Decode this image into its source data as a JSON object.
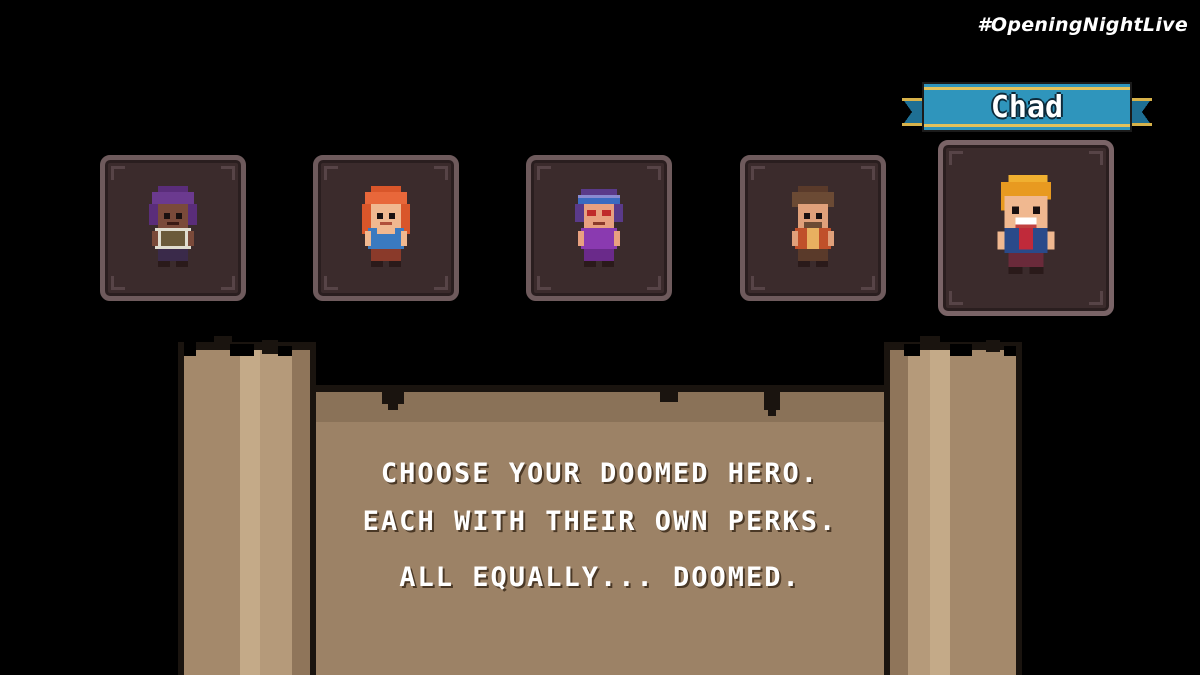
{
  "overlay": {
    "hashtag": "#OpeningNightLive"
  },
  "selection": {
    "selected_name": "Chad",
    "banner_color": "#2f95bc",
    "slots": [
      {
        "hero": "purple-hair-hero",
        "selected": false
      },
      {
        "hero": "red-hair-hero",
        "selected": false
      },
      {
        "hero": "headband-hero",
        "selected": false
      },
      {
        "hero": "brown-hair-hero",
        "selected": false
      },
      {
        "hero": "chad",
        "selected": true
      }
    ]
  },
  "scroll": {
    "color": "#9c8266",
    "lines": [
      "CHOOSE YOUR DOOMED HERO.",
      "EACH WITH THEIR OWN PERKS.",
      "ALL EQUALLY... DOOMED."
    ]
  }
}
